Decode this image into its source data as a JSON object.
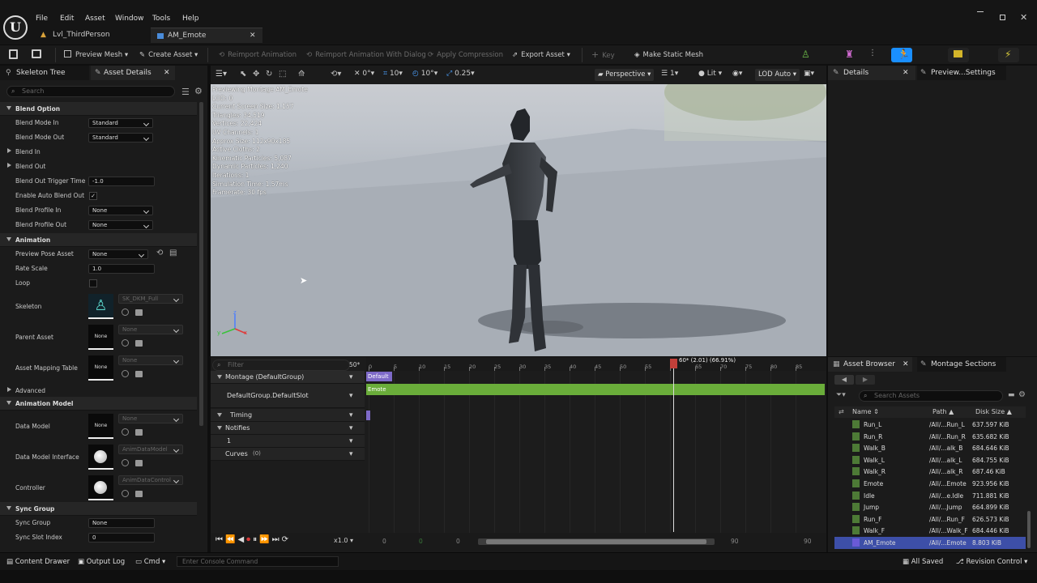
{
  "menu": [
    "File",
    "Edit",
    "Asset",
    "Window",
    "Tools",
    "Help"
  ],
  "tabs": {
    "level": "Lvl_ThirdPerson",
    "asset": "AM_Emote"
  },
  "toolbar": {
    "preview_mesh": "Preview Mesh",
    "create_asset": "Create Asset",
    "reimport": "Reimport Animation",
    "reimport_dialog": "Reimport Animation With Dialog",
    "apply_compression": "Apply Compression",
    "export_asset": "Export Asset",
    "key": "Key",
    "make_static": "Make Static Mesh"
  },
  "left": {
    "tab1": "Skeleton Tree",
    "tab2": "Asset Details",
    "search": "Search",
    "sections": {
      "blend_option": "Blend Option",
      "animation": "Animation",
      "advanced": "Advanced",
      "animation_model": "Animation Model",
      "sync_group": "Sync Group"
    },
    "props": {
      "blend_mode_in": {
        "label": "Blend Mode In",
        "value": "Standard"
      },
      "blend_mode_out": {
        "label": "Blend Mode Out",
        "value": "Standard"
      },
      "blend_in": "Blend In",
      "blend_out": "Blend Out",
      "blend_out_trigger": {
        "label": "Blend Out Trigger Time",
        "value": "-1.0"
      },
      "enable_auto_blend": {
        "label": "Enable Auto Blend Out"
      },
      "blend_profile_in": {
        "label": "Blend Profile In",
        "value": "None"
      },
      "blend_profile_out": {
        "label": "Blend Profile Out",
        "value": "None"
      },
      "preview_pose": {
        "label": "Preview Pose Asset",
        "value": "None"
      },
      "rate_scale": {
        "label": "Rate Scale",
        "value": "1.0"
      },
      "loop": {
        "label": "Loop"
      },
      "skeleton": {
        "label": "Skeleton",
        "value": "SK_DKM_Full"
      },
      "parent_asset": {
        "label": "Parent Asset",
        "value": "None",
        "thumb": "None"
      },
      "asset_mapping": {
        "label": "Asset Mapping Table",
        "value": "None",
        "thumb": "None"
      },
      "data_model": {
        "label": "Data Model",
        "value": "None",
        "thumb": "None"
      },
      "data_model_interface": {
        "label": "Data Model Interface",
        "value": "AnimDataModel"
      },
      "controller": {
        "label": "Controller",
        "value": "AnimDataControl"
      },
      "sync_group": {
        "label": "Sync Group",
        "value": "None"
      },
      "sync_slot": {
        "label": "Sync Slot Index",
        "value": "0"
      }
    }
  },
  "viewport": {
    "toolbar": {
      "snap1": "0°",
      "snap2": "10",
      "snap3": "10°",
      "snap4": "0.25",
      "perspective": "Perspective",
      "camera_speed": "1",
      "lit": "Lit",
      "lod": "LOD Auto"
    },
    "stats": [
      "Previewing Montage AM_Emote",
      "LOD: 0",
      "Current Screen Size: 1.157",
      "Triangles: 34,519",
      "Vertices: 22,424",
      "UV Channels: 1",
      "Approx Size: 112x90x185",
      "Active Cloths: 2",
      "Kinematic Particles: 5,087",
      "Dynamic Particles: 1,240",
      "Iterations: 1",
      "Simulation Time: 1.57ms",
      "Framerate: 30 fps"
    ],
    "axes": {
      "x": "x",
      "y": "y",
      "z": "z"
    }
  },
  "timeline": {
    "filter": "Filter",
    "frame_display": "50*",
    "playhead_label": "60* (2.01) (66.91%)",
    "ticks": [
      "0",
      "5",
      "10",
      "15",
      "20",
      "25",
      "30",
      "35",
      "40",
      "45",
      "50",
      "55",
      "60",
      "65",
      "70",
      "75",
      "80",
      "85"
    ],
    "tracks": {
      "montage": "Montage (DefaultGroup)",
      "slot": "DefaultGroup.DefaultSlot",
      "timing": "Timing",
      "notifies": "Notifies",
      "notify_1": "1",
      "curves": "Curves",
      "curves_count": "(0)"
    },
    "section_default": "Default",
    "segment_emote": "Emote",
    "playback_speed": "x1.0",
    "range": {
      "start": "0",
      "start2": "0",
      "start3": "0",
      "end": "90",
      "end2": "90"
    }
  },
  "right": {
    "details": "Details",
    "preview_settings": "Preview...Settings"
  },
  "asset_browser": {
    "tab": "Asset Browser",
    "tab2": "Montage Sections",
    "search": "Search Assets",
    "cols": {
      "name": "Name",
      "path": "Path",
      "size": "Disk Size"
    },
    "rows": [
      {
        "name": "Run_L",
        "path": "/All/...Run_L",
        "size": "637.597 KiB"
      },
      {
        "name": "Run_R",
        "path": "/All/...Run_R",
        "size": "635.682 KiB"
      },
      {
        "name": "Walk_B",
        "path": "/All/...alk_B",
        "size": "684.646 KiB"
      },
      {
        "name": "Walk_L",
        "path": "/All/...alk_L",
        "size": "684.755 KiB"
      },
      {
        "name": "Walk_R",
        "path": "/All/...alk_R",
        "size": "687.46 KiB"
      },
      {
        "name": "Emote",
        "path": "/All/...Emote",
        "size": "923.956 KiB"
      },
      {
        "name": "Idle",
        "path": "/All/...e.Idle",
        "size": "711.881 KiB"
      },
      {
        "name": "Jump",
        "path": "/All/...Jump",
        "size": "664.899 KiB"
      },
      {
        "name": "Run_F",
        "path": "/All/...Run_F",
        "size": "626.573 KiB"
      },
      {
        "name": "Walk_F",
        "path": "/All/...Walk_F",
        "size": "684.446 KiB"
      },
      {
        "name": "AM_Emote",
        "path": "/All/...Emote",
        "size": "8.803 KiB"
      }
    ]
  },
  "status": {
    "content_drawer": "Content Drawer",
    "output_log": "Output Log",
    "cmd": "Cmd",
    "console": "Enter Console Command",
    "all_saved": "All Saved",
    "revision": "Revision Control"
  }
}
